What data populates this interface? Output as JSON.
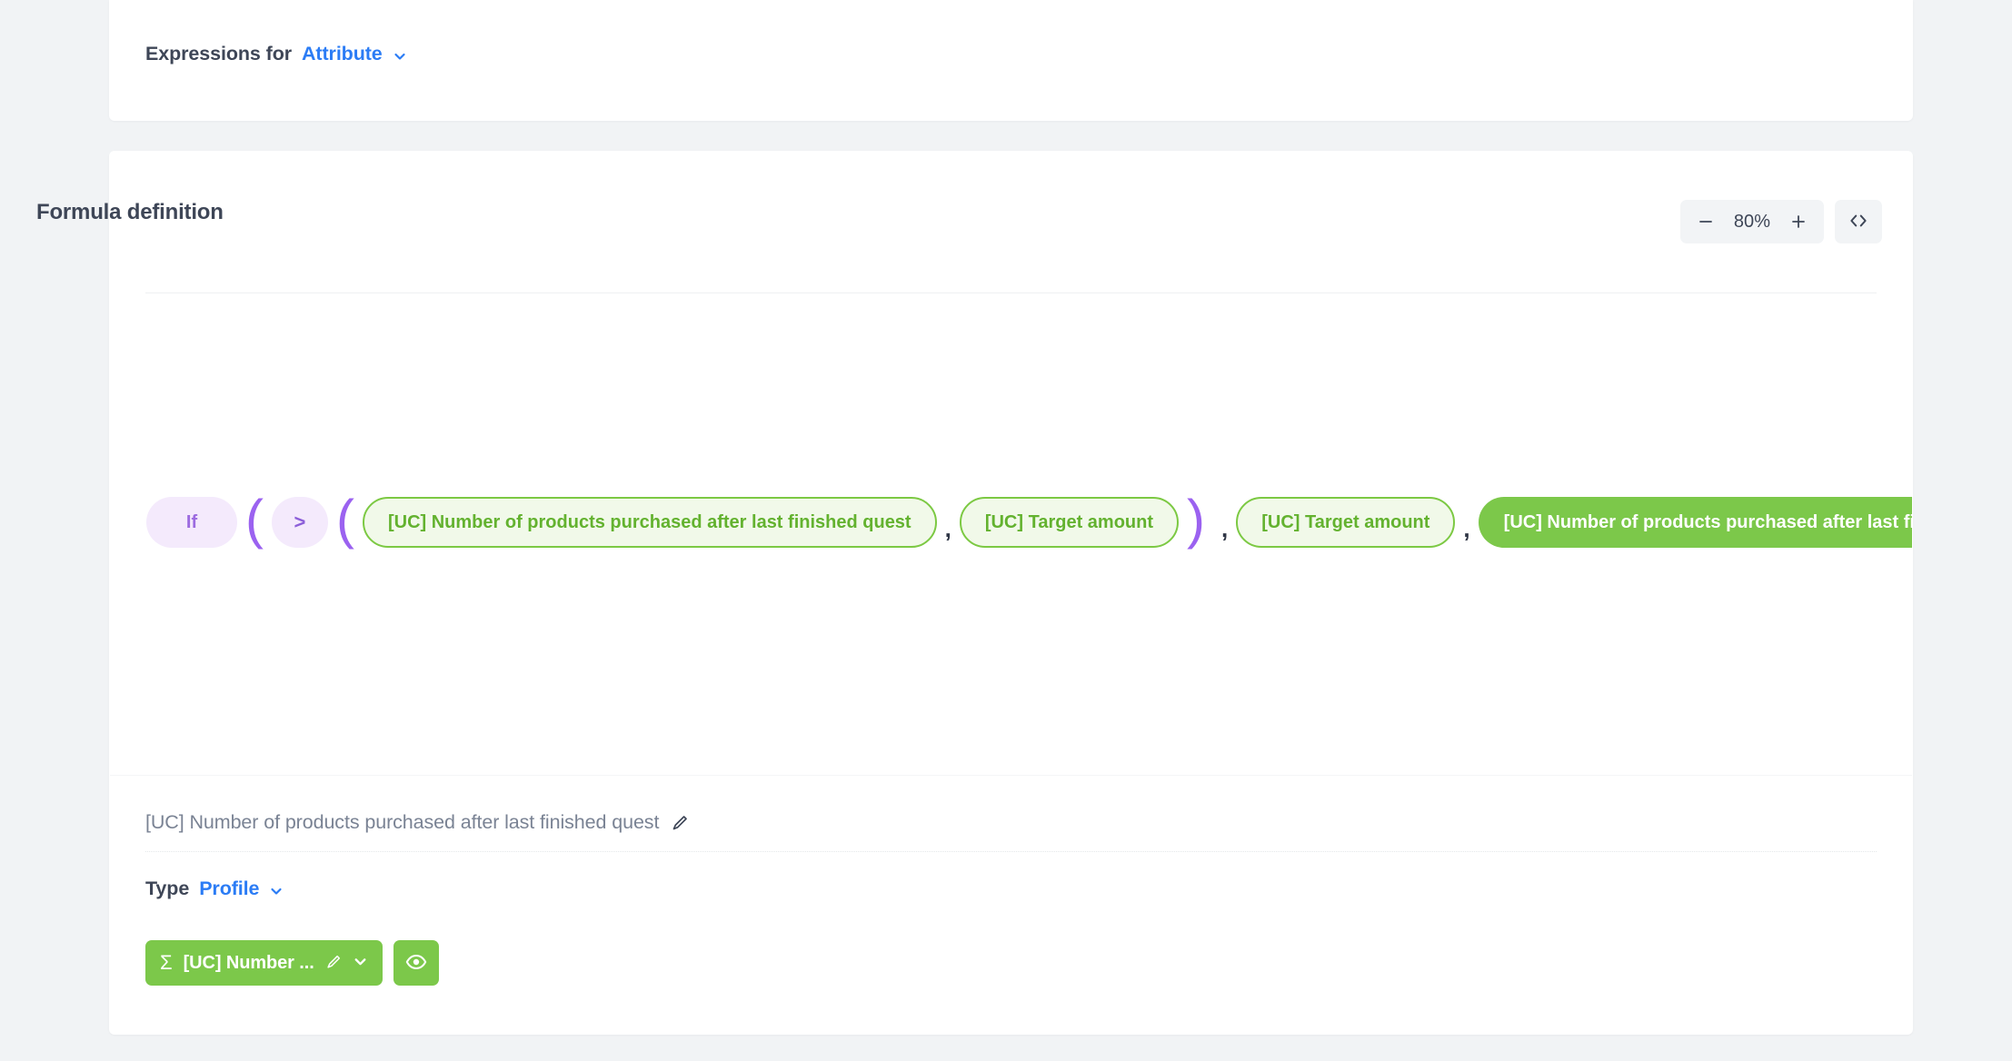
{
  "theme": {
    "page_bg": "#F1F3F5",
    "card_bg": "#FFFFFF",
    "accent_blue": "#2B7CF5",
    "text_dark": "#3E4657",
    "text_muted": "#7A8394",
    "green_fill": "#7CC84A",
    "green_border": "#7CC943",
    "green_text": "#63B22F",
    "green_soft_bg": "#F1F9E9",
    "purple_text": "#9C6BE0",
    "purple_soft_bg": "#F4EAFC",
    "paren_purple": "#9B62F0"
  },
  "expressions_header": {
    "label": "Expressions for",
    "selected": "Attribute",
    "chevron_icon": "chevron-down-icon"
  },
  "formula_card": {
    "title": "Formula definition",
    "zoom": {
      "minus_label": "−",
      "value": "80%",
      "plus_label": "+",
      "code_icon": "code-brackets-icon"
    },
    "tokens": [
      {
        "kind": "keyword",
        "text": "If"
      },
      {
        "kind": "paren",
        "text": "("
      },
      {
        "kind": "operator",
        "text": ">"
      },
      {
        "kind": "paren",
        "text": "("
      },
      {
        "kind": "chip_outline",
        "text": "[UC] Number of products purchased after last finished quest"
      },
      {
        "kind": "comma",
        "text": ","
      },
      {
        "kind": "chip_outline",
        "text": "[UC] Target amount"
      },
      {
        "kind": "paren_close",
        "text": ")"
      },
      {
        "kind": "comma",
        "text": ","
      },
      {
        "kind": "chip_outline",
        "text": "[UC] Target amount"
      },
      {
        "kind": "comma",
        "text": ","
      },
      {
        "kind": "chip_filled",
        "text": "[UC] Number of products purchased after last finished quest"
      }
    ]
  },
  "detail": {
    "label": "[UC] Number of products purchased after last finished quest",
    "edit_icon": "pencil-icon",
    "type_label": "Type",
    "type_value": "Profile",
    "type_chevron_icon": "chevron-down-icon",
    "measure": {
      "sigma_icon": "sigma-icon",
      "text": "[UC] Number ...",
      "edit_icon": "pencil-icon",
      "chevron_icon": "chevron-down-icon",
      "preview_icon": "eye-icon"
    }
  }
}
